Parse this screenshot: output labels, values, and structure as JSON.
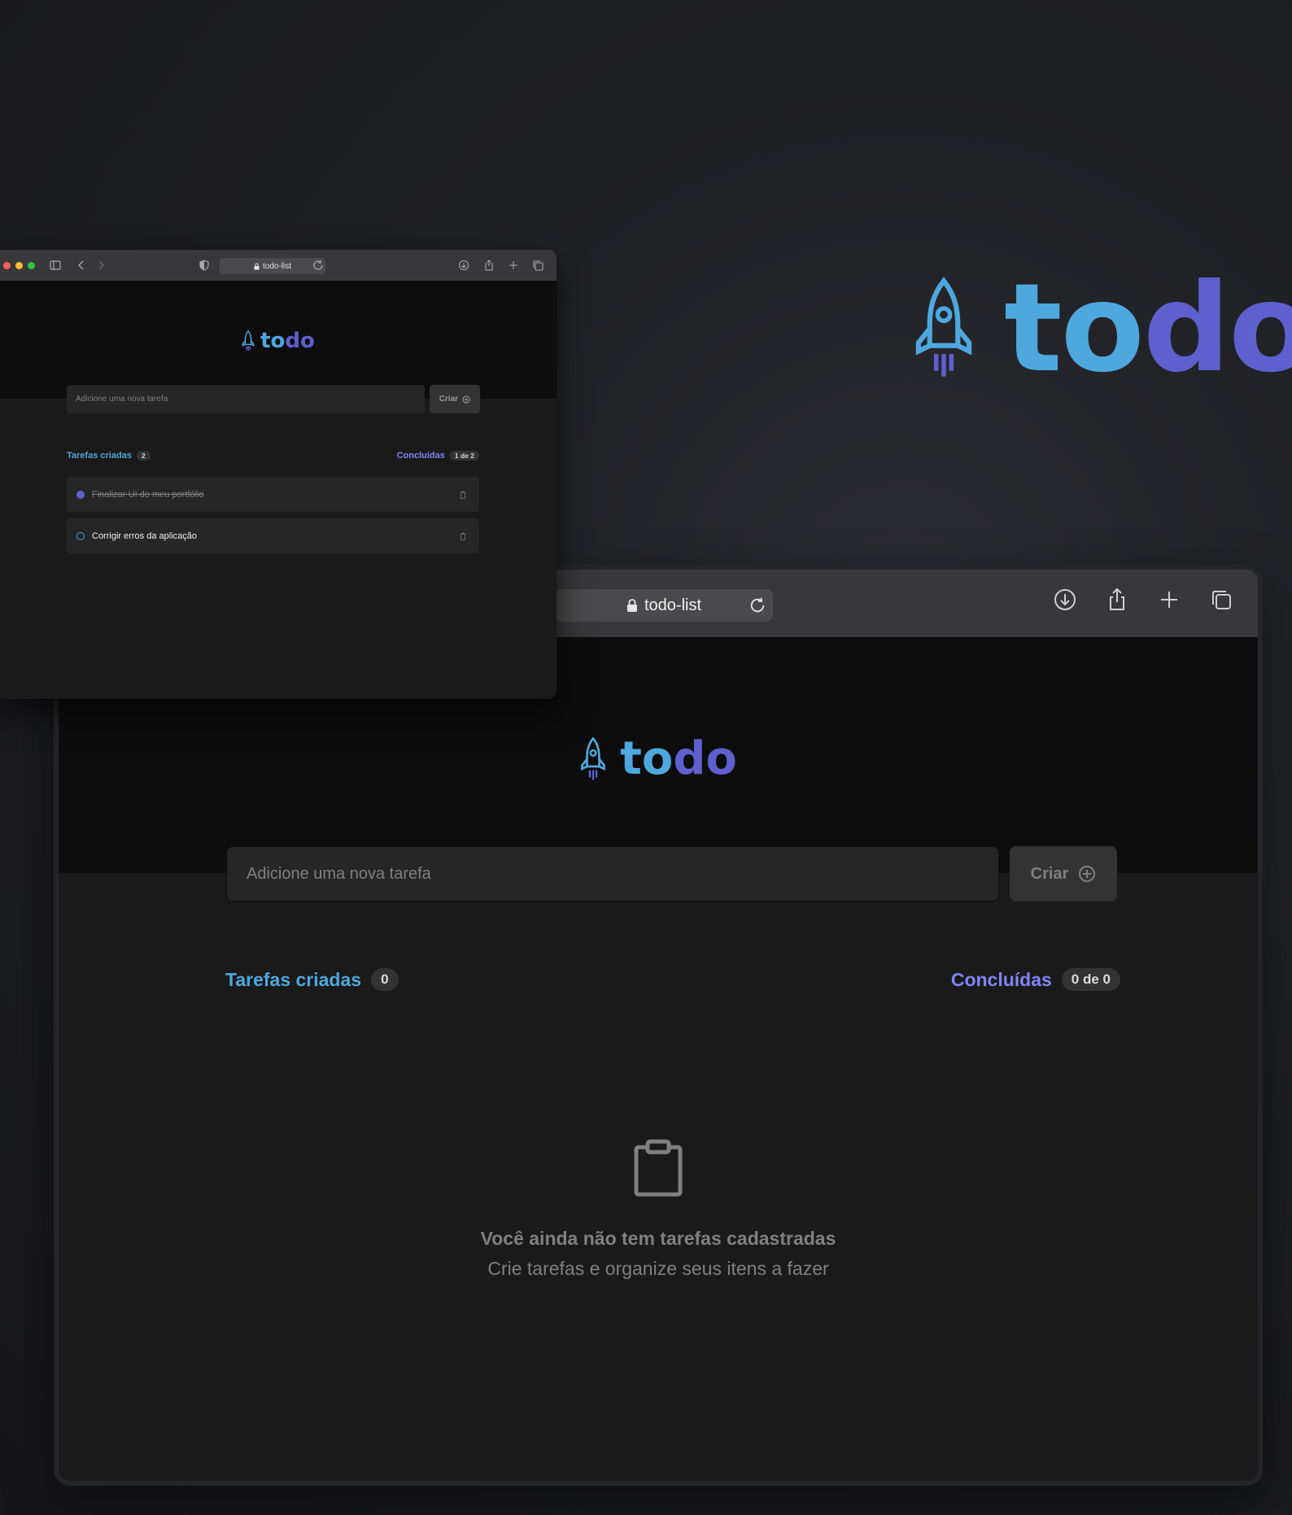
{
  "hero": {
    "logo_text_part1": "to",
    "logo_text_part2": "do"
  },
  "colors": {
    "blue": "#4ea8de",
    "purple": "#5e60ce",
    "bg": "#1a1a1a",
    "header_bg": "#0d0d0d",
    "input_bg": "#262626"
  },
  "main_window": {
    "url": "todo-list",
    "logo_part1": "to",
    "logo_part2": "do",
    "input_placeholder": "Adicione uma nova tarefa",
    "create_label": "Criar",
    "created_label": "Tarefas criadas",
    "created_count": "0",
    "done_label": "Concluídas",
    "done_count": "0 de 0",
    "empty_title": "Você ainda não tem tarefas cadastradas",
    "empty_subtitle": "Crie tarefas e organize seus itens a fazer",
    "icons": [
      "download-icon",
      "share-icon",
      "plus-icon",
      "tabs-icon",
      "reload-icon",
      "lock-icon",
      "clipboard-icon"
    ]
  },
  "mini_window": {
    "url": "todo-list",
    "logo_part1": "to",
    "logo_part2": "do",
    "input_placeholder": "Adicione uma nova tarefa",
    "create_label": "Criar",
    "created_label": "Tarefas criadas",
    "created_count": "2",
    "done_label": "Concluídas",
    "done_count": "1 de 2",
    "tasks": [
      {
        "label": "Finalizar UI do meu portfólio",
        "done": true
      },
      {
        "label": "Corrigir erros da aplicação",
        "done": false
      }
    ]
  }
}
